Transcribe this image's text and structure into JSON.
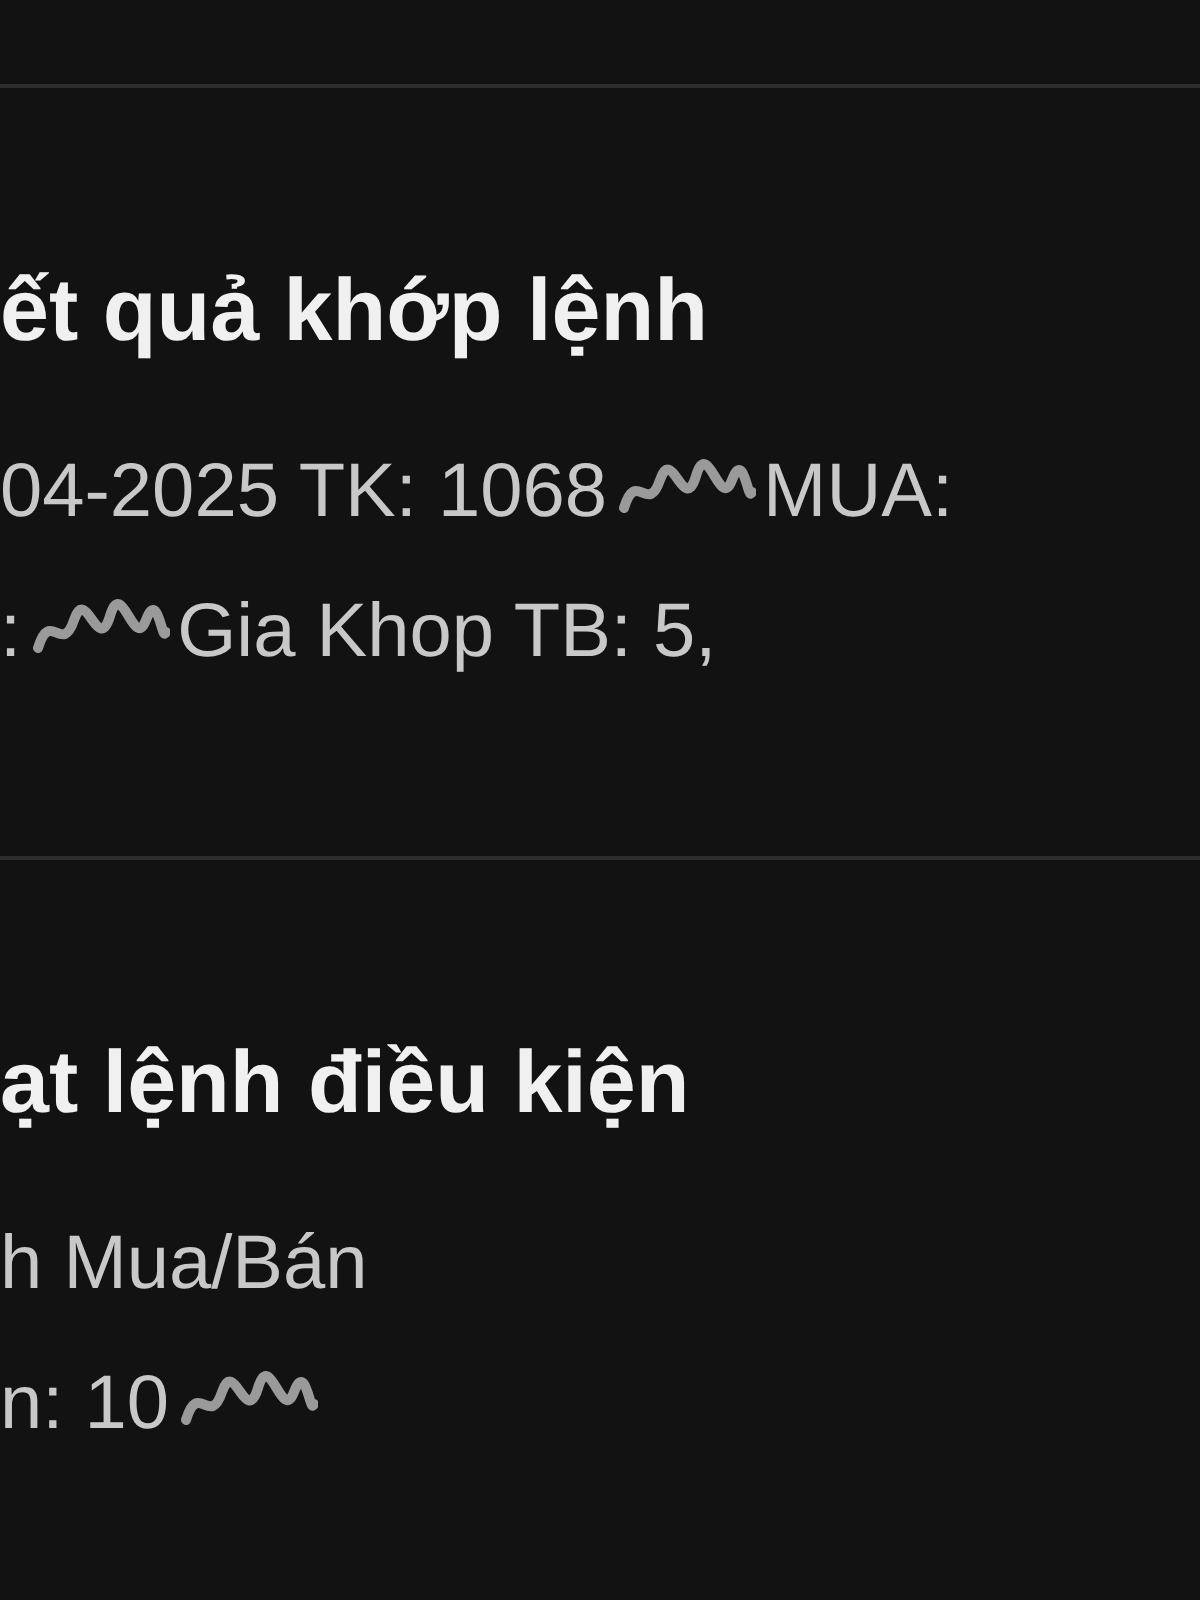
{
  "notifications": [
    {
      "title": "ết quả khớp lệnh",
      "lines": [
        [
          {
            "kind": "text",
            "text": "04-2025 TK: 1068"
          },
          {
            "kind": "obscured"
          },
          {
            "kind": "text",
            "text": "MUA:"
          }
        ],
        [
          {
            "kind": "text",
            "text": ":"
          },
          {
            "kind": "obscured"
          },
          {
            "kind": "text",
            "text": "Gia Khop TB: 5,"
          }
        ]
      ]
    },
    {
      "title": "ạt lệnh điều kiện",
      "lines": [
        [
          {
            "kind": "text",
            "text": "h Mua/Bán"
          }
        ],
        [
          {
            "kind": "text",
            "text": "n: 10"
          },
          {
            "kind": "obscured"
          }
        ]
      ]
    }
  ]
}
